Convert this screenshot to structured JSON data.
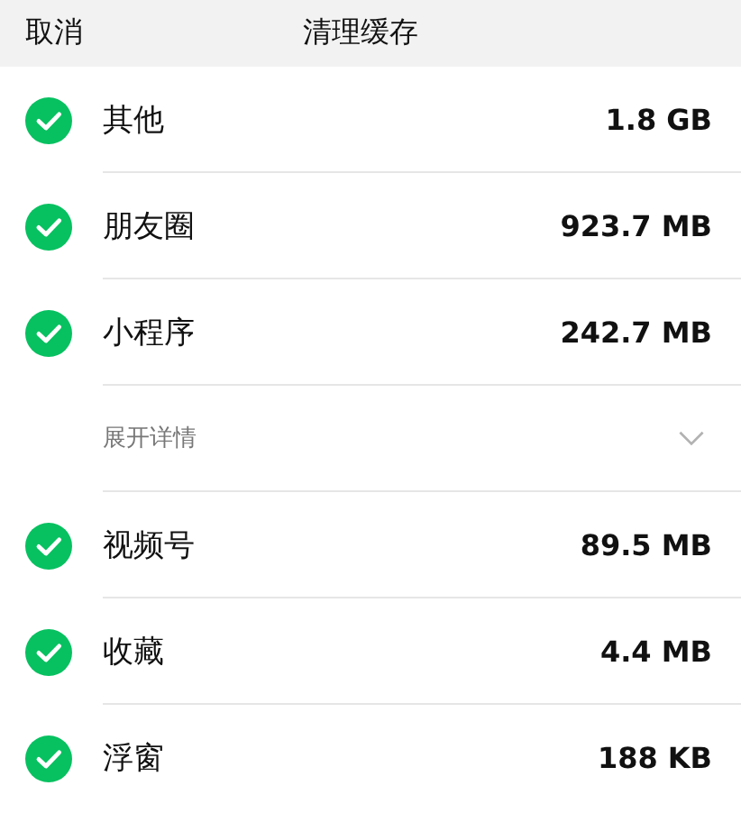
{
  "header": {
    "cancel": "取消",
    "title": "清理缓存"
  },
  "items": [
    {
      "kind": "item",
      "name": "其他",
      "size": "1.8 GB",
      "checked": true
    },
    {
      "kind": "item",
      "name": "朋友圈",
      "size": "923.7 MB",
      "checked": true
    },
    {
      "kind": "item",
      "name": "小程序",
      "size": "242.7 MB",
      "checked": true
    },
    {
      "kind": "expander",
      "label": "展开详情",
      "expanded": false
    },
    {
      "kind": "item",
      "name": "视频号",
      "size": "89.5 MB",
      "checked": true
    },
    {
      "kind": "item",
      "name": "收藏",
      "size": "4.4 MB",
      "checked": true
    },
    {
      "kind": "item",
      "name": "浮窗",
      "size": "188 KB",
      "checked": true
    }
  ]
}
